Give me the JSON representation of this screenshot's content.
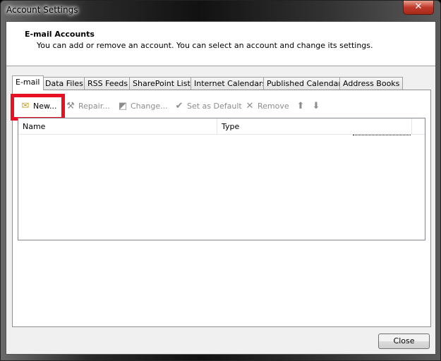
{
  "window": {
    "title": "Account Settings",
    "close_glyph": "✕"
  },
  "header": {
    "title": "E-mail Accounts",
    "description": "You can add or remove an account. You can select an account and change its settings."
  },
  "tabs": [
    {
      "label": "E-mail",
      "active": true
    },
    {
      "label": "Data Files"
    },
    {
      "label": "RSS Feeds"
    },
    {
      "label": "SharePoint Lists"
    },
    {
      "label": "Internet Calendars"
    },
    {
      "label": "Published Calendars"
    },
    {
      "label": "Address Books"
    }
  ],
  "toolbar": {
    "new": "New...",
    "repair": "Repair...",
    "change": "Change...",
    "set_default": "Set as Default",
    "remove": "Remove"
  },
  "list": {
    "columns": [
      "Name",
      "Type"
    ]
  },
  "footer": {
    "close": "Close"
  },
  "colors": {
    "highlight": "#e81123"
  }
}
